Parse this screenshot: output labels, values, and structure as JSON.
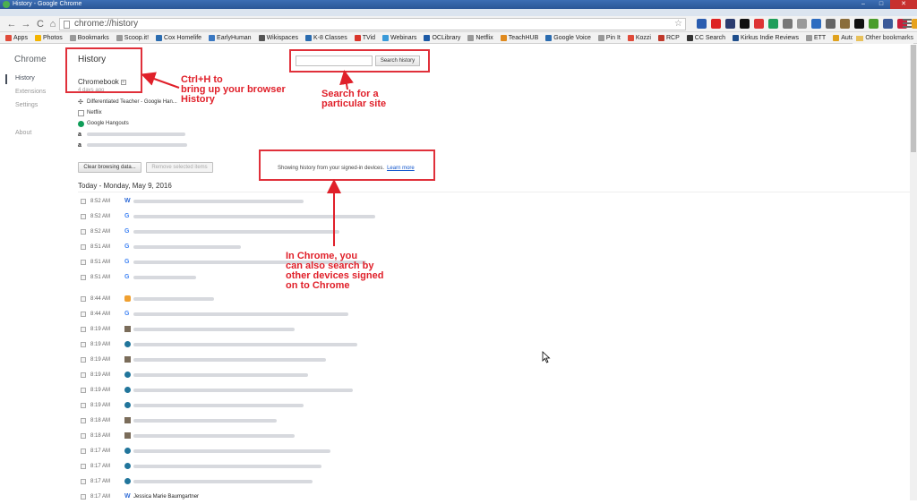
{
  "window": {
    "title": "History - Google Chrome"
  },
  "toolbar": {
    "url": "chrome://history"
  },
  "bookmarks": [
    {
      "label": "Apps",
      "icon": "apps-icon",
      "color": "#e04b3a"
    },
    {
      "label": "Photos",
      "icon": "photos-icon",
      "color": "#f4b400"
    },
    {
      "label": "Bookmarks",
      "icon": "page-icon",
      "color": "#999999"
    },
    {
      "label": "Scoop.it!",
      "icon": "page-icon",
      "color": "#999999"
    },
    {
      "label": "Cox Homelife",
      "icon": "cox-icon",
      "color": "#2b6cb0"
    },
    {
      "label": "EarlyHuman",
      "icon": "earlyhuman-icon",
      "color": "#3a78c2"
    },
    {
      "label": "Wikispaces",
      "icon": "wikispaces-icon",
      "color": "#555555"
    },
    {
      "label": "K-8 Classes",
      "icon": "k8-icon",
      "color": "#2b6cb0"
    },
    {
      "label": "TVid",
      "icon": "tvid-icon",
      "color": "#d9352b"
    },
    {
      "label": "Webinars",
      "icon": "webinars-icon",
      "color": "#3a9ad9"
    },
    {
      "label": "OCLibrary",
      "icon": "library-icon",
      "color": "#1c5aa6"
    },
    {
      "label": "Netflix",
      "icon": "page-icon",
      "color": "#999999"
    },
    {
      "label": "TeachHUB",
      "icon": "teachhub-icon",
      "color": "#e08a1e"
    },
    {
      "label": "Google Voice",
      "icon": "voice-icon",
      "color": "#2b6cb0"
    },
    {
      "label": "Pin It",
      "icon": "page-icon",
      "color": "#999999"
    },
    {
      "label": "Kozzi",
      "icon": "kozzi-icon",
      "color": "#e04b3a"
    },
    {
      "label": "RCP",
      "icon": "rcp-icon",
      "color": "#c0392b"
    },
    {
      "label": "CC Search",
      "icon": "cc-icon",
      "color": "#333333"
    },
    {
      "label": "Kirkus Indie Reviews",
      "icon": "kirkus-icon",
      "color": "#1f4e8c"
    },
    {
      "label": "ETT",
      "icon": "page-icon",
      "color": "#999999"
    },
    {
      "label": "AutoCrit",
      "icon": "autocrit-icon",
      "color": "#e0a21e"
    }
  ],
  "other_bookmarks": "Other bookmarks",
  "sidebar": {
    "brand": "Chrome",
    "items": [
      {
        "label": "History",
        "selected": true
      },
      {
        "label": "Extensions",
        "selected": false
      },
      {
        "label": "Settings",
        "selected": false
      },
      {
        "label": "About",
        "selected": false
      }
    ]
  },
  "main": {
    "title": "History",
    "search_placeholder": "",
    "search_button": "Search history",
    "device": {
      "name": "Chromebook",
      "date": "4 days ago",
      "tabs": [
        {
          "title": "Differentiated Teacher - Google Han...",
          "icon": "dt-icon"
        },
        {
          "title": "Netflix",
          "icon": "page-icon"
        },
        {
          "title": "Google Hangouts",
          "icon": "hangouts-icon"
        },
        {
          "title": "",
          "icon": "amazon-icon"
        },
        {
          "title": "",
          "icon": "amazon-icon"
        }
      ]
    },
    "clear_button": "Clear browsing data...",
    "remove_button": "Remove selected items",
    "notice": "Showing history from your signed-in devices.",
    "notice_link": "Learn more",
    "day_header": "Today - Monday, May 9, 2016",
    "entries": [
      {
        "time": "8:52 AM",
        "icon": "w",
        "title": "",
        "gap": false
      },
      {
        "time": "8:52 AM",
        "icon": "g",
        "title": "",
        "gap": false
      },
      {
        "time": "8:52 AM",
        "icon": "g",
        "title": "",
        "gap": false
      },
      {
        "time": "8:51 AM",
        "icon": "g",
        "title": "",
        "gap": false
      },
      {
        "time": "8:51 AM",
        "icon": "g",
        "title": "",
        "gap": false
      },
      {
        "time": "8:51 AM",
        "icon": "g",
        "title": "",
        "gap": false
      },
      {
        "time": "8:44 AM",
        "icon": "or",
        "title": "",
        "gap": true
      },
      {
        "time": "8:44 AM",
        "icon": "g",
        "title": "",
        "gap": false
      },
      {
        "time": "8:19 AM",
        "icon": "img",
        "title": "",
        "gap": false
      },
      {
        "time": "8:19 AM",
        "icon": "wp",
        "title": "",
        "gap": false
      },
      {
        "time": "8:19 AM",
        "icon": "img",
        "title": "",
        "gap": false
      },
      {
        "time": "8:19 AM",
        "icon": "wp",
        "title": "",
        "gap": false
      },
      {
        "time": "8:19 AM",
        "icon": "wp",
        "title": "",
        "gap": false
      },
      {
        "time": "8:19 AM",
        "icon": "wp",
        "title": "",
        "gap": false
      },
      {
        "time": "8:18 AM",
        "icon": "img",
        "title": "",
        "gap": false
      },
      {
        "time": "8:18 AM",
        "icon": "img",
        "title": "",
        "gap": false
      },
      {
        "time": "8:17 AM",
        "icon": "wp",
        "title": "",
        "gap": false
      },
      {
        "time": "8:17 AM",
        "icon": "wp",
        "title": "",
        "gap": false
      },
      {
        "time": "8:17 AM",
        "icon": "wp",
        "title": "",
        "gap": false
      },
      {
        "time": "8:17 AM",
        "icon": "w",
        "title": "Jessica Marie Baumgartner",
        "gap": false
      }
    ]
  },
  "annotations": {
    "ctrl_h": [
      "Ctrl+H to",
      "bring up your browser",
      "History"
    ],
    "search_site": [
      "Search for a",
      "particular site"
    ],
    "devices": [
      "In Chrome, you",
      "can also search by",
      "other devices signed",
      "on to Chrome"
    ]
  },
  "colors": {
    "annotation": "#e0202a",
    "link": "#1155cc",
    "accent": "#464e5a"
  }
}
